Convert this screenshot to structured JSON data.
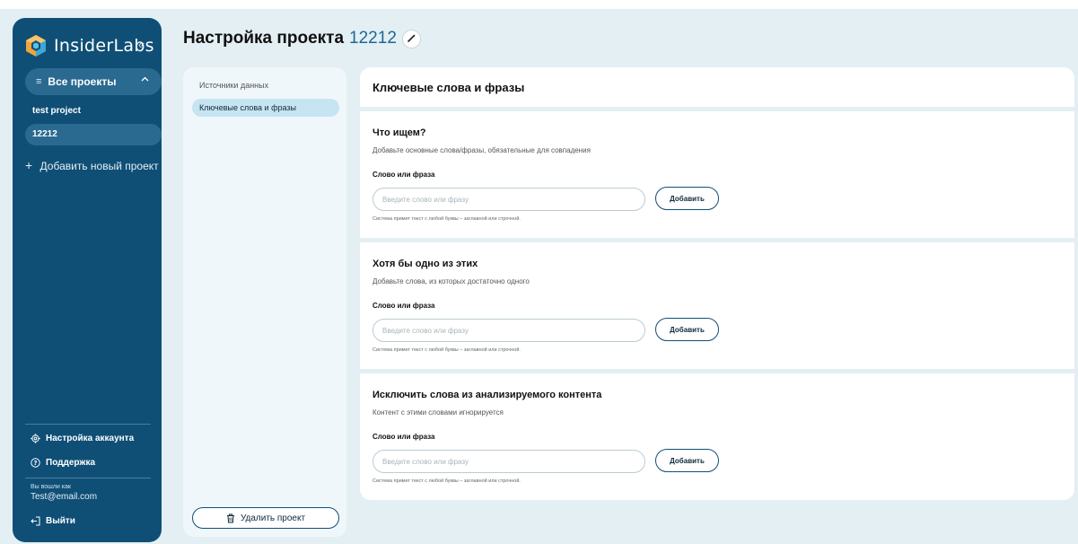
{
  "sidebar": {
    "brand": "InsiderLabs",
    "collapse_glyph": "«",
    "all_projects_label": "Все проекты",
    "projects": [
      "test project",
      "12212"
    ],
    "add_project_label": "Добавить новый проект",
    "account_settings_label": "Настройка аккаунта",
    "support_label": "Поддержка",
    "logged_in_as_label": "Вы вошли как",
    "user_email": "Test@email.com",
    "logout_label": "Выйти"
  },
  "page": {
    "title": "Настройка проекта",
    "project_number": "12212"
  },
  "nav": {
    "items": [
      "Источники данных",
      "Ключевые слова и фразы"
    ],
    "active_index": 1,
    "delete_label": "Удалить проект"
  },
  "content": {
    "header": "Ключевые слова и фразы",
    "sections": [
      {
        "title": "Что ищем?",
        "description": "Добавьте основные слова/фразы, обязательные для совпадения",
        "field_label": "Слово или фраза",
        "placeholder": "Введите слово или фразу",
        "add_label": "Добавить",
        "hint": "Система примет текст с любой буквы – заглавной или строчной."
      },
      {
        "title": "Хотя бы одно из этих",
        "description": "Добавьте слова, из которых достаточно одного",
        "field_label": "Слово или фраза",
        "placeholder": "Введите слово или фразу",
        "add_label": "Добавить",
        "hint": "Система примет текст с любой буквы – заглавной или строчной."
      },
      {
        "title": "Исключить слова из анализируемого контента",
        "description": "Контент с этими словами игнорируется",
        "field_label": "Слово или фраза",
        "placeholder": "Введите слово или фразу",
        "add_label": "Добавить",
        "hint": "Система примет текст с любой буквы – заглавной или строчной."
      }
    ]
  },
  "colors": {
    "sidebar_bg": "#0f4f76",
    "active_item_bg": "#2a6a91",
    "page_bg": "#e3eff3",
    "nav_active_bg": "#c6e4f2",
    "accent_number": "#1b6a96"
  },
  "icons": [
    "logo-hexagon-icon",
    "menu-lines-icon",
    "chevron-up-icon",
    "plus-icon",
    "gear-icon",
    "help-circle-icon",
    "logout-icon",
    "pencil-icon",
    "trash-icon"
  ]
}
